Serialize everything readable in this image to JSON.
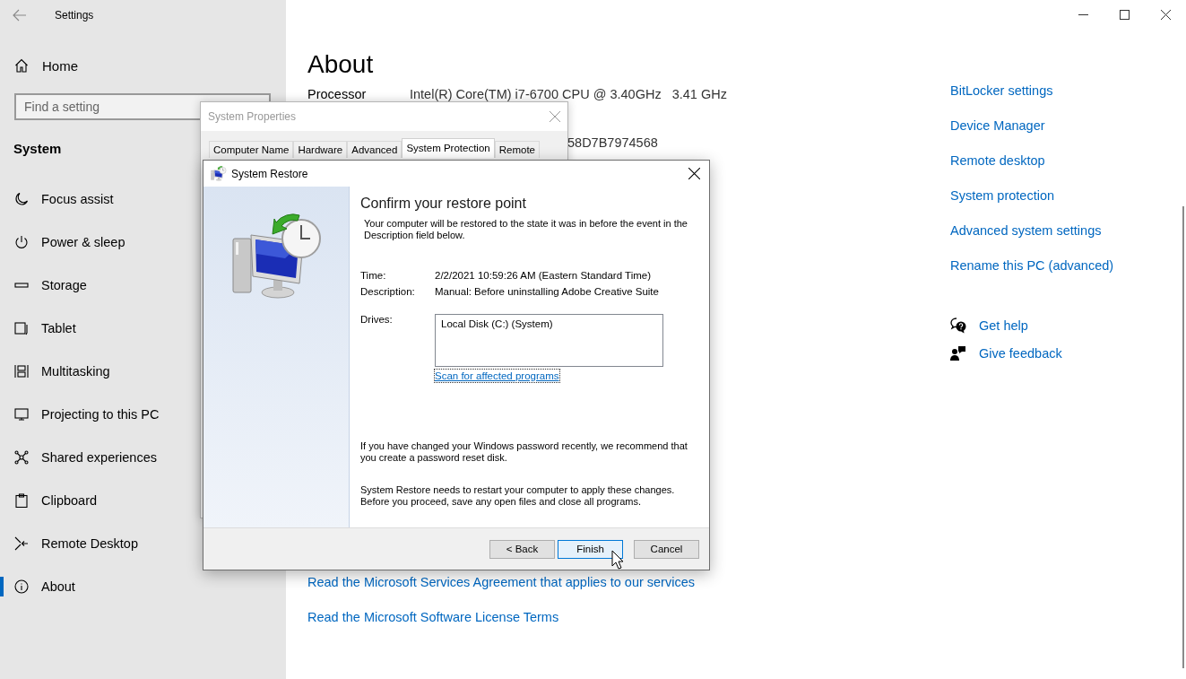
{
  "window": {
    "title": "Settings"
  },
  "sidebar": {
    "home": "Home",
    "search": {
      "placeholder": "Find a setting"
    },
    "section": "System",
    "items": [
      {
        "label": "Focus assist",
        "selected": false
      },
      {
        "label": "Power & sleep",
        "selected": false
      },
      {
        "label": "Storage",
        "selected": false
      },
      {
        "label": "Tablet",
        "selected": false
      },
      {
        "label": "Multitasking",
        "selected": false
      },
      {
        "label": "Projecting to this PC",
        "selected": false
      },
      {
        "label": "Shared experiences",
        "selected": false
      },
      {
        "label": "Clipboard",
        "selected": false
      },
      {
        "label": "Remote Desktop",
        "selected": false
      },
      {
        "label": "About",
        "selected": true
      }
    ]
  },
  "about": {
    "title": "About",
    "specs": [
      {
        "label": "Processor",
        "value": "Intel(R) Core(TM) i7-6700 CPU @ 3.40GHz   3.41 GHz"
      },
      {
        "value": "58D7B7974568"
      }
    ],
    "links": [
      "Read the Microsoft Services Agreement that applies to our services",
      "Read the Microsoft Software License Terms"
    ]
  },
  "related": {
    "links": [
      "BitLocker settings",
      "Device Manager",
      "Remote desktop",
      "System protection",
      "Advanced system settings",
      "Rename this PC (advanced)"
    ],
    "support": [
      {
        "kind": "help",
        "label": "Get help"
      },
      {
        "kind": "feedback",
        "label": "Give feedback"
      }
    ]
  },
  "system_properties": {
    "title": "System Properties",
    "tabs": [
      {
        "label": "Computer Name",
        "selected": false
      },
      {
        "label": "Hardware",
        "selected": false
      },
      {
        "label": "Advanced",
        "selected": false
      },
      {
        "label": "System Protection",
        "selected": true
      },
      {
        "label": "Remote",
        "selected": false
      }
    ]
  },
  "system_restore": {
    "title": "System Restore",
    "heading": "Confirm your restore point",
    "intro": "Your computer will be restored to the state it was in before the event in the Description field below.",
    "fields": [
      {
        "label": "Time:",
        "value": "2/2/2021 10:59:26 AM (Eastern Standard Time)"
      },
      {
        "label": "Description:",
        "value": "Manual: Before uninstalling Adobe Creative Suite"
      }
    ],
    "drives": {
      "label": "Drives:",
      "items": [
        "Local Disk (C:) (System)"
      ]
    },
    "scan_link": "Scan for affected programs",
    "notes": [
      "If you have changed your Windows password recently, we recommend that you create a password reset disk.",
      "System Restore needs to restart your computer to apply these changes. Before you proceed, save any open files and close all programs."
    ],
    "buttons": [
      {
        "label": "< Back",
        "focused": false
      },
      {
        "label": "Finish",
        "focused": true
      },
      {
        "label": "Cancel",
        "focused": false
      }
    ]
  }
}
